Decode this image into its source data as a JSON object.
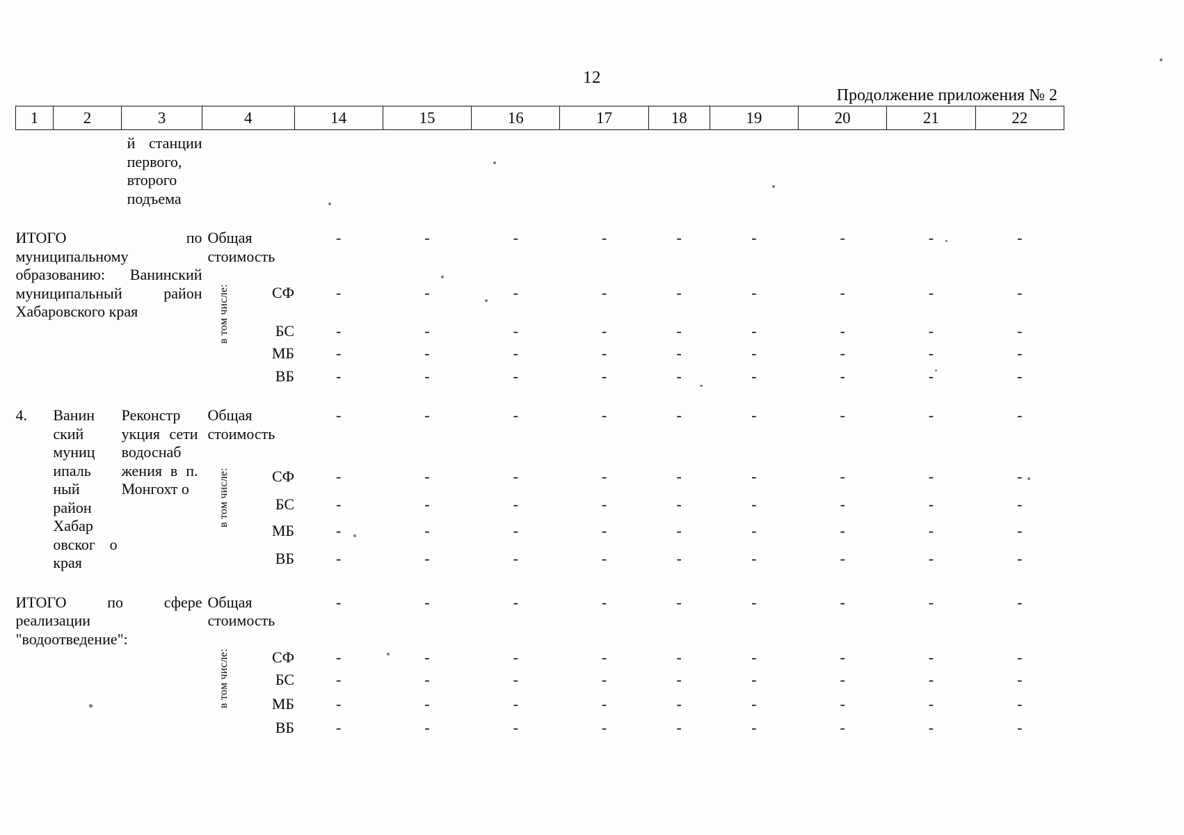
{
  "document": {
    "page_number": "12",
    "appendix_note": "Продолжение приложения № 2"
  },
  "table": {
    "column_numbers": [
      "1",
      "2",
      "3",
      "4",
      "14",
      "15",
      "16",
      "17",
      "18",
      "19",
      "20",
      "21",
      "22"
    ],
    "empty_value": "-",
    "vertical_label": "в том числе:",
    "source_labels": {
      "total": "Общая стоимость",
      "sf": "СФ",
      "bs": "БС",
      "mb": "МБ",
      "vb": "ВБ"
    },
    "rows": [
      {
        "kind": "continuation",
        "col1": "",
        "col2": "",
        "col3": "й станции первого, второго подъема",
        "values": []
      },
      {
        "kind": "subtotal",
        "description": "ИТОГО по муниципальному образованию: Ванинский муниципальный район Хабаровского края",
        "lines": [
          {
            "label": "Общая стоимость",
            "values": [
              "-",
              "-",
              "-",
              "-",
              "-",
              "-",
              "-",
              "-",
              "-"
            ]
          },
          {
            "label": "СФ",
            "values": [
              "-",
              "-",
              "-",
              "-",
              "-",
              "-",
              "-",
              "-",
              "-"
            ]
          },
          {
            "label": "БС",
            "values": [
              "-",
              "-",
              "-",
              "-",
              "-",
              "-",
              "-",
              "-",
              "-"
            ]
          },
          {
            "label": "МБ",
            "values": [
              "-",
              "-",
              "-",
              "-",
              "-",
              "-",
              "-",
              "-",
              "-"
            ]
          },
          {
            "label": "ВБ",
            "values": [
              "-",
              "-",
              "-",
              "-",
              "-",
              "-",
              "-",
              "-",
              "-"
            ]
          }
        ]
      },
      {
        "kind": "item",
        "col1": "4.",
        "col2": "Ванин ский муниц ипаль ный район Хабар овског о края",
        "col3": "Реконстр укция сети водоснаб жения в п. Монгохт о",
        "lines": [
          {
            "label": "Общая стоимость",
            "values": [
              "-",
              "-",
              "-",
              "-",
              "-",
              "-",
              "-",
              "-",
              "-"
            ]
          },
          {
            "label": "СФ",
            "values": [
              "-",
              "-",
              "-",
              "-",
              "-",
              "-",
              "-",
              "-",
              "-"
            ]
          },
          {
            "label": "БС",
            "values": [
              "-",
              "-",
              "-",
              "-",
              "-",
              "-",
              "-",
              "-",
              "-"
            ]
          },
          {
            "label": "МБ",
            "values": [
              "-",
              "-",
              "-",
              "-",
              "-",
              "-",
              "-",
              "-",
              "-"
            ]
          },
          {
            "label": "ВБ",
            "values": [
              "-",
              "-",
              "-",
              "-",
              "-",
              "-",
              "-",
              "-",
              "-"
            ]
          }
        ]
      },
      {
        "kind": "subtotal",
        "description": "ИТОГО по сфере реализации \"водоотведение\":",
        "lines": [
          {
            "label": "Общая стоимость",
            "values": [
              "-",
              "-",
              "-",
              "-",
              "-",
              "-",
              "-",
              "-",
              "-"
            ]
          },
          {
            "label": "СФ",
            "values": [
              "-",
              "-",
              "-",
              "-",
              "-",
              "-",
              "-",
              "-",
              "-"
            ]
          },
          {
            "label": "БС",
            "values": [
              "-",
              "-",
              "-",
              "-",
              "-",
              "-",
              "-",
              "-",
              "-"
            ]
          },
          {
            "label": "МБ",
            "values": [
              "-",
              "-",
              "-",
              "-",
              "-",
              "-",
              "-",
              "-",
              "-"
            ]
          },
          {
            "label": "ВБ",
            "values": [
              "-",
              "-",
              "-",
              "-",
              "-",
              "-",
              "-",
              "-",
              "-"
            ]
          }
        ]
      }
    ]
  }
}
